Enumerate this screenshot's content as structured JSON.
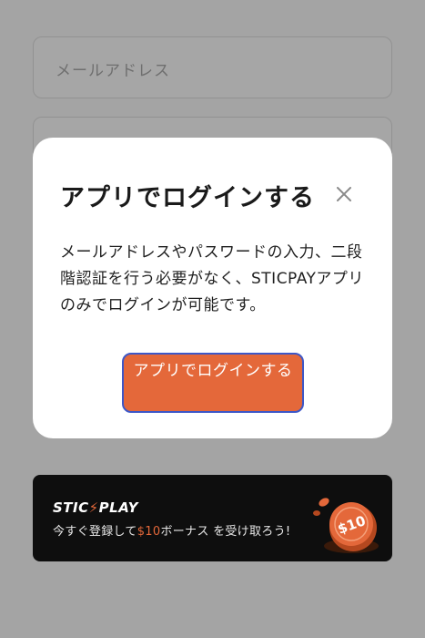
{
  "form": {
    "email_placeholder": "メールアドレス"
  },
  "modal": {
    "title": "アプリでログインする",
    "body": "メールアドレスやパスワードの入力、二段階認証を行う必要がなく、STICPAYアプリのみでログインが可能です。",
    "button_label": "アプリでログインする"
  },
  "banner": {
    "logo_part1": "STIC",
    "logo_arrow": "⚡",
    "logo_part2": "PLAY",
    "text_before": "今すぐ登録して",
    "text_accent": "$10",
    "text_after": "ボーナス を受け取ろう!",
    "coin_label": "$10"
  },
  "colors": {
    "overlay": "#a4a4a4",
    "accent": "#e4683a",
    "button_border": "#3d57c7",
    "banner_bg": "#0e0e0e"
  }
}
